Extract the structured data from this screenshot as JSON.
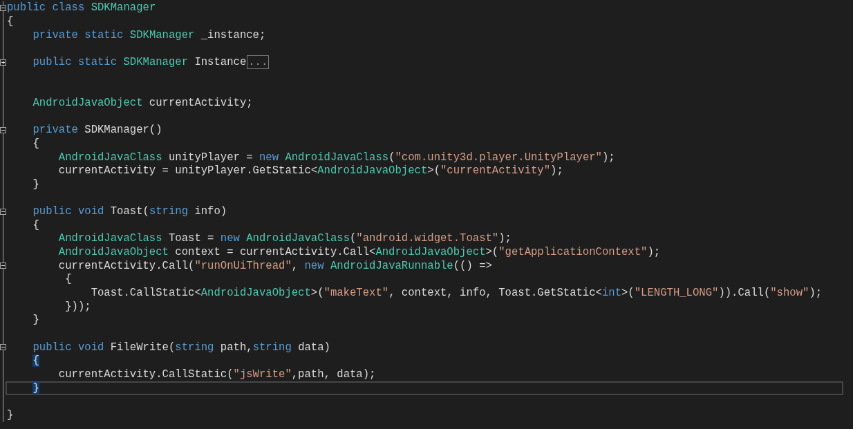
{
  "editor": {
    "lines": [
      {
        "current": false,
        "collapsed": false,
        "tokens": [
          {
            "kind": "keyword",
            "text": "public class "
          },
          {
            "kind": "type",
            "text": "SDKManager"
          }
        ]
      },
      {
        "current": false,
        "tokens": [
          {
            "kind": "plain",
            "text": "{"
          }
        ]
      },
      {
        "current": false,
        "tokens": [
          {
            "kind": "keyword",
            "text": "    private static "
          },
          {
            "kind": "type",
            "text": "SDKManager"
          },
          {
            "kind": "plain",
            "text": " _instance;"
          }
        ]
      },
      {
        "current": false
      },
      {
        "current": false,
        "collapsed": true,
        "tokens": [
          {
            "kind": "keyword",
            "text": "    public static "
          },
          {
            "kind": "type",
            "text": "SDKManager"
          },
          {
            "kind": "plain",
            "text": " Instance"
          },
          {
            "kind": "collapsed",
            "text": "..."
          }
        ]
      },
      {
        "current": false
      },
      {
        "current": false
      },
      {
        "current": false,
        "tokens": [
          {
            "kind": "type",
            "text": "    AndroidJavaObject"
          },
          {
            "kind": "plain",
            "text": " currentActivity;"
          }
        ]
      },
      {
        "current": false
      },
      {
        "current": false,
        "collapsed": false,
        "tokens": [
          {
            "kind": "keyword",
            "text": "    private "
          },
          {
            "kind": "plain",
            "text": "SDKManager()"
          }
        ]
      },
      {
        "current": false,
        "tokens": [
          {
            "kind": "plain",
            "text": "    {"
          }
        ]
      },
      {
        "current": false,
        "tokens": [
          {
            "kind": "type",
            "text": "        AndroidJavaClass"
          },
          {
            "kind": "plain",
            "text": " unityPlayer = "
          },
          {
            "kind": "keyword",
            "text": "new "
          },
          {
            "kind": "type",
            "text": "AndroidJavaClass"
          },
          {
            "kind": "plain",
            "text": "("
          },
          {
            "kind": "string",
            "text": "\"com.unity3d.player.UnityPlayer\""
          },
          {
            "kind": "plain",
            "text": ");"
          }
        ]
      },
      {
        "current": false,
        "tokens": [
          {
            "kind": "plain",
            "text": "        currentActivity = unityPlayer.GetStatic<"
          },
          {
            "kind": "type",
            "text": "AndroidJavaObject"
          },
          {
            "kind": "plain",
            "text": ">("
          },
          {
            "kind": "string",
            "text": "\"currentActivity\""
          },
          {
            "kind": "plain",
            "text": ");"
          }
        ]
      },
      {
        "current": false,
        "tokens": [
          {
            "kind": "plain",
            "text": "    }"
          }
        ]
      },
      {
        "current": false
      },
      {
        "current": false,
        "collapsed": false,
        "tokens": [
          {
            "kind": "keyword",
            "text": "    public void "
          },
          {
            "kind": "plain",
            "text": "Toast("
          },
          {
            "kind": "keyword",
            "text": "string"
          },
          {
            "kind": "plain",
            "text": " info)"
          }
        ]
      },
      {
        "current": false,
        "tokens": [
          {
            "kind": "plain",
            "text": "    {"
          }
        ]
      },
      {
        "current": false,
        "tokens": [
          {
            "kind": "type",
            "text": "        AndroidJavaClass"
          },
          {
            "kind": "plain",
            "text": " Toast = "
          },
          {
            "kind": "keyword",
            "text": "new "
          },
          {
            "kind": "type",
            "text": "AndroidJavaClass"
          },
          {
            "kind": "plain",
            "text": "("
          },
          {
            "kind": "string",
            "text": "\"android.widget.Toast\""
          },
          {
            "kind": "plain",
            "text": ");"
          }
        ]
      },
      {
        "current": false,
        "tokens": [
          {
            "kind": "type",
            "text": "        AndroidJavaObject"
          },
          {
            "kind": "plain",
            "text": " context = currentActivity.Call<"
          },
          {
            "kind": "type",
            "text": "AndroidJavaObject"
          },
          {
            "kind": "plain",
            "text": ">("
          },
          {
            "kind": "string",
            "text": "\"getApplicationContext\""
          },
          {
            "kind": "plain",
            "text": ");"
          }
        ]
      },
      {
        "current": false,
        "collapsed": false,
        "tokens": [
          {
            "kind": "plain",
            "text": "        currentActivity.Call("
          },
          {
            "kind": "string",
            "text": "\"runOnUiThread\""
          },
          {
            "kind": "plain",
            "text": ", "
          },
          {
            "kind": "keyword",
            "text": "new "
          },
          {
            "kind": "type",
            "text": "AndroidJavaRunnable"
          },
          {
            "kind": "plain",
            "text": "(() =>"
          }
        ]
      },
      {
        "current": false,
        "tokens": [
          {
            "kind": "plain",
            "text": "         {"
          }
        ]
      },
      {
        "current": false,
        "tokens": [
          {
            "kind": "plain",
            "text": "             Toast.CallStatic<"
          },
          {
            "kind": "type",
            "text": "AndroidJavaObject"
          },
          {
            "kind": "plain",
            "text": ">("
          },
          {
            "kind": "string",
            "text": "\"makeText\""
          },
          {
            "kind": "plain",
            "text": ", context, info, Toast.GetStatic<"
          },
          {
            "kind": "keyword",
            "text": "int"
          },
          {
            "kind": "plain",
            "text": ">("
          },
          {
            "kind": "string",
            "text": "\"LENGTH_LONG\""
          },
          {
            "kind": "plain",
            "text": ")).Call("
          },
          {
            "kind": "string",
            "text": "\"show\""
          },
          {
            "kind": "plain",
            "text": ");"
          }
        ]
      },
      {
        "current": false,
        "tokens": [
          {
            "kind": "plain",
            "text": "         }));"
          }
        ]
      },
      {
        "current": false,
        "tokens": [
          {
            "kind": "plain",
            "text": "    }"
          }
        ]
      },
      {
        "current": false
      },
      {
        "current": false,
        "collapsed": false,
        "tokens": [
          {
            "kind": "keyword",
            "text": "    public void "
          },
          {
            "kind": "plain",
            "text": "FileWrite("
          },
          {
            "kind": "keyword",
            "text": "string"
          },
          {
            "kind": "plain",
            "text": " path,"
          },
          {
            "kind": "keyword",
            "text": "string"
          },
          {
            "kind": "plain",
            "text": " data)"
          }
        ]
      },
      {
        "current": false,
        "tokens": [
          {
            "kind": "brace_match",
            "text": "    {"
          }
        ]
      },
      {
        "current": false,
        "tokens": [
          {
            "kind": "plain",
            "text": "        currentActivity.CallStatic("
          },
          {
            "kind": "string",
            "text": "\"jsWrite\""
          },
          {
            "kind": "plain",
            "text": ",path, data);"
          }
        ]
      },
      {
        "current": true,
        "tokens": [
          {
            "kind": "brace_match",
            "text": "    }"
          }
        ]
      },
      {
        "current": false
      },
      {
        "current": false,
        "tokens": [
          {
            "kind": "plain",
            "text": "}"
          }
        ]
      }
    ]
  }
}
